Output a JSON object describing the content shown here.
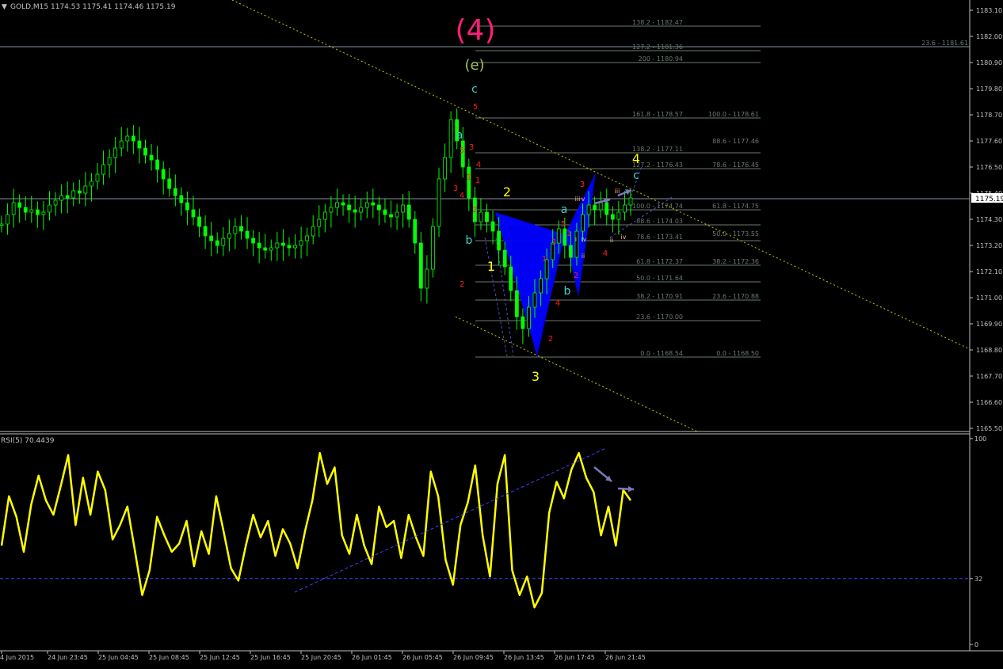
{
  "chart_data": [
    {
      "type": "line",
      "symbol": "GOLD,M15",
      "ohlc_readout": "1174.53 1175.41 1174.46 1175.19",
      "current_price": "1175.19",
      "ylim": [
        1165.5,
        1183.6
      ],
      "y_ticks": [
        "1183.10",
        "1182.00",
        "1180.90",
        "1179.80",
        "1178.70",
        "1177.60",
        "1176.50",
        "1175.40",
        "1174.30",
        "1173.20",
        "1172.10",
        "1171.00",
        "1169.90",
        "1168.80",
        "1167.70",
        "1166.60",
        "1165.50"
      ],
      "y_tick_values": [
        1183.1,
        1182.0,
        1180.9,
        1179.8,
        1178.7,
        1177.6,
        1176.5,
        1175.4,
        1174.3,
        1173.2,
        1172.1,
        1171.0,
        1169.9,
        1168.8,
        1167.7,
        1166.6,
        1165.5
      ],
      "x_ticks": [
        "4 Jun 2015",
        "24 Jun 23:45",
        "25 Jun 04:45",
        "25 Jun 08:45",
        "25 Jun 12:45",
        "25 Jun 16:45",
        "25 Jun 20:45",
        "26 Jun 01:45",
        "26 Jun 05:45",
        "26 Jun 09:45",
        "26 Jun 13:45",
        "26 Jun 17:45",
        "26 Jun 21:45"
      ],
      "series": [
        {
          "values": [
            1174.1,
            1174.5,
            1175.0,
            1174.8,
            1174.6,
            1174.7,
            1174.5,
            1174.6,
            1174.9,
            1175.1,
            1175.3,
            1175.2,
            1175.5,
            1175.4,
            1175.7,
            1175.9,
            1176.2,
            1176.6,
            1176.9,
            1177.3,
            1177.6,
            1177.8,
            1177.6,
            1177.3,
            1177.0,
            1176.8,
            1176.4,
            1176.0,
            1175.6,
            1175.3,
            1175.0,
            1174.7,
            1174.4,
            1174.0,
            1173.6,
            1173.4,
            1173.2,
            1173.5,
            1173.7,
            1174.0,
            1173.8,
            1173.5,
            1173.3,
            1173.1,
            1173.0,
            1173.1,
            1173.3,
            1173.2,
            1173.1,
            1173.2,
            1173.4,
            1173.6,
            1174.0,
            1174.3,
            1174.6,
            1174.8,
            1175.0,
            1174.9,
            1174.7,
            1174.6,
            1174.8,
            1175.0,
            1174.9,
            1174.7,
            1174.5,
            1174.4,
            1174.6,
            1174.9,
            1174.3,
            1173.3,
            1171.4,
            1172.2,
            1174.0,
            1176.0,
            1176.9,
            1178.5,
            1177.6,
            1176.5,
            1175.2,
            1174.2,
            1174.6,
            1174.2,
            1173.8,
            1173.0,
            1172.3,
            1171.3,
            1170.2,
            1169.7,
            1170.6,
            1171.2,
            1171.8,
            1172.6,
            1173.3,
            1173.9,
            1173.2,
            1172.7,
            1173.8,
            1174.5,
            1174.9,
            1174.7,
            1175.0,
            1174.5,
            1174.3,
            1174.6,
            1174.9,
            1175.2
          ]
        }
      ]
    },
    {
      "type": "line",
      "title": "RSI(5) 70.4439",
      "ylim": [
        0,
        100
      ],
      "y_ticks": [
        "100",
        "32",
        "0"
      ],
      "y_tick_values": [
        100,
        32,
        0
      ],
      "levels": [
        32
      ],
      "series": [
        {
          "values": [
            48,
            72,
            62,
            45,
            68,
            82,
            70,
            63,
            77,
            92,
            58,
            81,
            63,
            84,
            75,
            51,
            58,
            67,
            46,
            24,
            36,
            62,
            53,
            45,
            49,
            60,
            38,
            55,
            44,
            72,
            55,
            37,
            31,
            48,
            63,
            52,
            60,
            43,
            56,
            49,
            37,
            55,
            70,
            93,
            78,
            86,
            53,
            44,
            63,
            48,
            39,
            67,
            57,
            60,
            42,
            63,
            52,
            43,
            84,
            72,
            41,
            29,
            58,
            69,
            87,
            53,
            33,
            78,
            92,
            36,
            24,
            33,
            18,
            25,
            64,
            79,
            71,
            85,
            93,
            81,
            74,
            53,
            67,
            48,
            75,
            70
          ]
        }
      ]
    }
  ],
  "fib_left": [
    "138.2 - 1182.47",
    "127.2 - 1181.36",
    "200 - 1180.94",
    "161.8 - 1178.57",
    "138.2 - 1177.11",
    "127.2 - 1176.43",
    "100.0 - 1174.74",
    "88.6 - 1174.03",
    "78.6 - 1173.41",
    "61.8 - 1172.37",
    "50.0 - 1171.64",
    "38.2 - 1170.91",
    "23.6 - 1170.00",
    "0.0 - 1168.54"
  ],
  "fib_right": [
    "100.0 - 1178.61",
    "88.6 - 1177.46",
    "78.6 - 1176.45",
    "61.8 - 1174.75",
    "50.0 - 1173.55",
    "38.2 - 1172.36",
    "23.6 - 1170.88",
    "0.0 - 1168.50"
  ],
  "fib_far": "23.6 - 1181.61",
  "wave_labels": {
    "w4_big": "(4)",
    "we": "(e)",
    "c_top": "c",
    "a_left": "a",
    "b_left": "b",
    "n1": "1",
    "n2": "2",
    "n3": "3",
    "n4": "4",
    "a_mid": "a",
    "b_mid": "b",
    "c_right": "c",
    "r5a": "5",
    "r5b": "5",
    "r3a": "3",
    "r3b": "3",
    "r4a": "4",
    "r4b": "4",
    "r1a": "1",
    "r1b": "1",
    "r2a": "2",
    "r2b": "2",
    "r2c": "2",
    "r1c": "1",
    "r3c": "3",
    "r4c": "4",
    "r5c": "5",
    "r1d": "1",
    "r2d": "2",
    "r3d": "3",
    "r4d": "4",
    "iii_a": "iii",
    "v_a": "v",
    "ii_a": "ii",
    "iii_b": "iii",
    "ii_b": "ii",
    "iv_b": "iv",
    "i_a": "i",
    "iv_a": "iv"
  },
  "colors": {
    "candle": "#00ff00",
    "rsi": "#ffff00",
    "pattern": "#0000ff",
    "channel": "#c8c800",
    "fib": "#6b7a70",
    "grid_label": "#c0c0c0",
    "magenta": "#ff1e78",
    "olive": "#a0c060",
    "cyan": "#3fd0d0",
    "red": "#ff2020",
    "yellow": "#ffff00",
    "arrow": "#7a7ab8"
  }
}
